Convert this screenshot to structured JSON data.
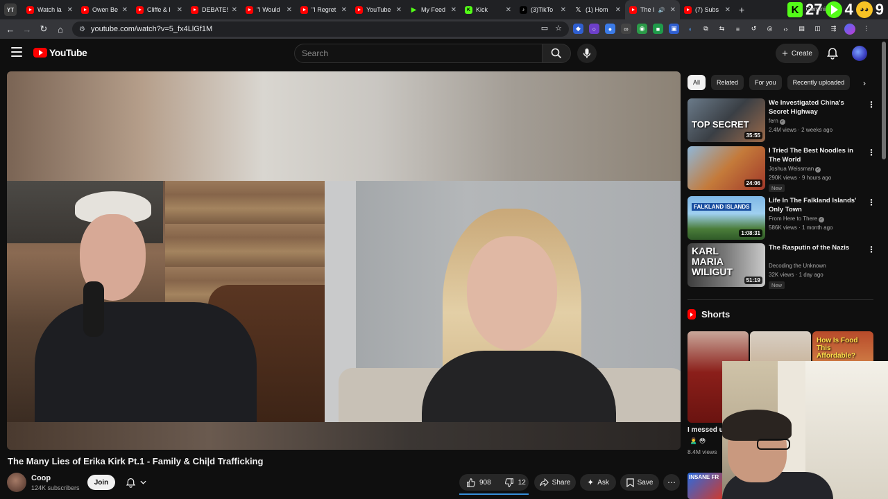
{
  "browser": {
    "window_badge": "YT",
    "tabs": [
      {
        "label": "Watch la",
        "icon": "youtube-icon",
        "active": false
      },
      {
        "label": "Owen Be",
        "icon": "youtube-icon",
        "active": false
      },
      {
        "label": "Cliffe & I",
        "icon": "youtube-icon",
        "active": false
      },
      {
        "label": "DEBATE!",
        "icon": "youtube-icon",
        "active": false
      },
      {
        "label": "\"I Would",
        "icon": "youtube-icon",
        "active": false
      },
      {
        "label": "\"I Regret",
        "icon": "youtube-icon",
        "active": false
      },
      {
        "label": "YouTube",
        "icon": "youtube-icon",
        "active": false
      },
      {
        "label": "My Feed",
        "icon": "play-icon",
        "active": false
      },
      {
        "label": "Kick",
        "icon": "kick-icon",
        "active": false
      },
      {
        "label": "(3)TikTo",
        "icon": "tiktok-icon",
        "active": false
      },
      {
        "label": "(1) Hom",
        "icon": "x-icon",
        "active": false
      },
      {
        "label": "The I",
        "icon": "youtube-icon",
        "active": true
      },
      {
        "label": "(7) Subs",
        "icon": "youtube-icon",
        "active": false
      }
    ],
    "new_tab": "+",
    "overlay": {
      "k_label": "K",
      "count_a": "27",
      "gemini": "Gemini",
      "count_b": "4",
      "count_c": "9"
    },
    "url": "youtube.com/watch?v=5_fx4LlGf1M"
  },
  "masthead": {
    "logo_text": "YouTube",
    "search_placeholder": "Search",
    "create_label": "Create"
  },
  "video": {
    "title": "The Many Lies of Erika Kirk Pt.1 - Family & Chi|d Trafficking",
    "channel": "Coop",
    "subscribers": "124K subscribers",
    "join_label": "Join",
    "likes": "908",
    "dislikes": "12",
    "share_label": "Share",
    "ask_label": "Ask",
    "save_label": "Save"
  },
  "sidebar": {
    "chips": [
      "All",
      "Related",
      "For you",
      "Recently uploaded"
    ],
    "recommendations": [
      {
        "title": "We Investigated China's Secret Highway",
        "channel": "fern",
        "meta": "2.4M views · 2 weeks ago",
        "duration": "35:55",
        "badge": "",
        "thumb_text": "TOP SECRET"
      },
      {
        "title": "I Tried The Best Noodles in The World",
        "channel": "Joshua Weissman",
        "meta": "290K views · 9 hours ago",
        "duration": "24:06",
        "badge": "New",
        "thumb_text": ""
      },
      {
        "title": "Life In The Falkland Islands' Only Town",
        "channel": "From Here to There",
        "meta": "586K views · 1 month ago",
        "duration": "1:08:31",
        "badge": "",
        "thumb_text": "FALKLAND ISLANDS"
      },
      {
        "title": "The Rasputin of the Nazis",
        "channel": "Decoding the Unknown",
        "meta": "32K views · 1 day ago",
        "duration": "51:19",
        "badge": "New",
        "thumb_text": "KARL MARIA WILIGUT"
      }
    ],
    "shorts_heading": "Shorts",
    "shorts": [
      {
        "thumb_text": ""
      },
      {
        "thumb_text": ""
      },
      {
        "thumb_text": "How Is Food This Affordable?"
      }
    ],
    "short_title": "I messed u",
    "short_views": "8.4M views",
    "bottom_thumb_text": "INSANE FR"
  },
  "colors": {
    "youtube_red": "#ff0000",
    "background": "#0f0f0f",
    "chip_bg": "#272727",
    "kick_green": "#53fc18"
  }
}
